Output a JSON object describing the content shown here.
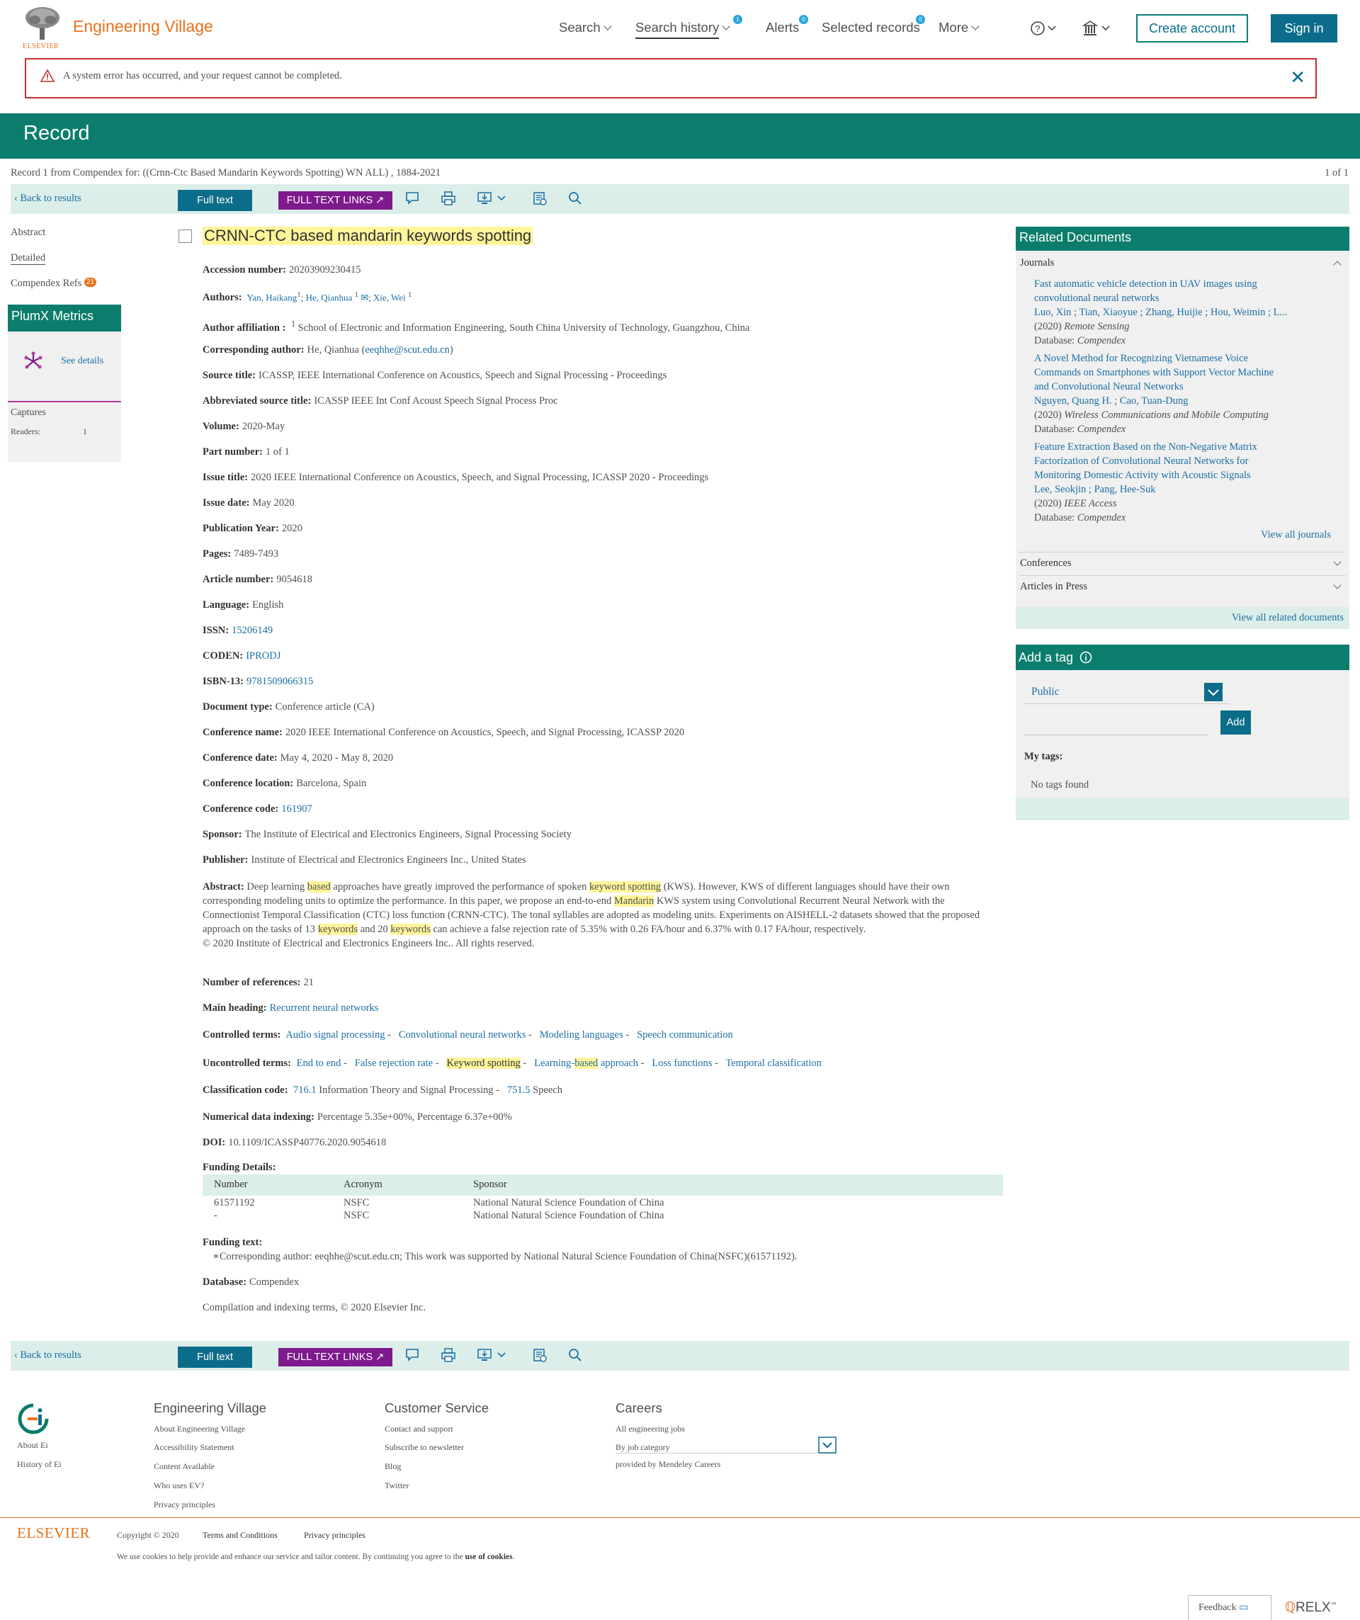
{
  "header": {
    "brand": "Engineering Village",
    "elsevier_small": "ELSEVIER",
    "nav": {
      "search": "Search",
      "search_history": "Search history",
      "search_history_badge": "1",
      "alerts": "Alerts",
      "alerts_badge": "0",
      "selected_records": "Selected records",
      "selected_badge": "0",
      "more": "More"
    },
    "create_account": "Create account",
    "sign_in": "Sign in"
  },
  "error": {
    "text": "A system error has occurred, and your request cannot be completed."
  },
  "record_bar": {
    "title": "Record"
  },
  "record_line": "Record 1 from Compendex for: ((Crnn-Ctc Based Mandarin Keywords Spotting) WN ALL) , 1884-2021",
  "of_line": "1 of 1",
  "toolbar": {
    "back": "Back to results",
    "full_text": "Full text",
    "full_text_links": "FULL TEXT LINKS"
  },
  "left_nav": {
    "abstract": "Abstract",
    "detailed": "Detailed",
    "compendex_refs": "Compendex Refs",
    "refs_count": "21",
    "plumx_title": "PlumX Metrics",
    "see_details": "See details",
    "captures": "Captures",
    "readers_label": "Readers:",
    "readers_value": "1"
  },
  "record": {
    "title": "CRNN-CTC based mandarin keywords spotting",
    "accession_label": "Accession number:",
    "accession": "20203909230415",
    "authors_label": "Authors:",
    "author1": "Yan, Haikang",
    "author2": "He, Qianhua",
    "author3": "Xie, Wei",
    "sup": "1",
    "affiliation_label": "Author affiliation :",
    "affiliation": "School of Electronic and Information Engineering, South China University of Technology, Guangzhou, China",
    "corresponding_label": "Corresponding author:",
    "corresponding_name": "He, Qianhua (",
    "corresponding_email": "eeqhhe@scut.edu.cn",
    "corresponding_close": ")",
    "source_label": "Source title:",
    "source": "ICASSP, IEEE International Conference on Acoustics, Speech and Signal Processing - Proceedings",
    "abbr_label": "Abbreviated source title:",
    "abbr": "ICASSP IEEE Int Conf Acoust Speech Signal Process Proc",
    "volume_label": "Volume:",
    "volume": "2020-May",
    "part_label": "Part number:",
    "part": "1 of 1",
    "issue_title_label": "Issue title:",
    "issue_title": "2020 IEEE International Conference on Acoustics, Speech, and Signal Processing, ICASSP 2020 - Proceedings",
    "issue_date_label": "Issue date:",
    "issue_date": "May 2020",
    "pub_year_label": "Publication Year:",
    "pub_year": "2020",
    "pages_label": "Pages:",
    "pages": "7489-7493",
    "article_label": "Article number:",
    "article": "9054618",
    "language_label": "Language:",
    "language": "English",
    "issn_label": "ISSN:",
    "issn": "15206149",
    "coden_label": "CODEN:",
    "coden": "IPRODJ",
    "isbn_label": "ISBN-13:",
    "isbn": "9781509066315",
    "doctype_label": "Document type:",
    "doctype": "Conference article (CA)",
    "conf_name_label": "Conference name:",
    "conf_name": "2020 IEEE International Conference on Acoustics, Speech, and Signal Processing, ICASSP 2020",
    "conf_date_label": "Conference date:",
    "conf_date": "May 4, 2020 - May 8, 2020",
    "conf_loc_label": "Conference location:",
    "conf_loc": "Barcelona, Spain",
    "conf_code_label": "Conference code:",
    "conf_code": "161907",
    "sponsor_label": "Sponsor:",
    "sponsor": "The Institute of Electrical and Electronics Engineers, Signal Processing Society",
    "publisher_label": "Publisher:",
    "publisher": "Institute of Electrical and Electronics Engineers Inc., United States",
    "abstract_label": "Abstract:",
    "abstract_parts": [
      "Deep learning ",
      "based",
      " approaches have greatly improved the performance of spoken ",
      "keyword spotting",
      " (KWS). However, KWS of different languages should have their own corresponding modeling units to optimize the performance. In this paper, we propose an end-to-end ",
      "Mandarin",
      " KWS system using Convolutional Recurrent Neural Network with the Connectionist Temporal Classification (CTC) loss function (CRNN-CTC). The tonal syllables are adopted as modeling units. Experiments on AISHELL-2 datasets showed that the proposed approach on the tasks of 13 ",
      "keywords",
      " and 20 ",
      "keywords",
      " can achieve a false rejection rate of 5.35% with 0.26 FA/hour and 6.37% with 0.17 FA/hour, respectively."
    ],
    "copyright": "© 2020 Institute of Electrical and Electronics Engineers Inc.. All rights reserved.",
    "num_refs_label": "Number of references:",
    "num_refs": "21",
    "main_heading_label": "Main heading:",
    "main_heading": "Recurrent neural networks",
    "controlled_label": "Controlled terms:",
    "controlled": [
      "Audio signal processing",
      "Convolutional neural networks",
      "Modeling languages",
      "Speech communication"
    ],
    "uncontrolled_label": "Uncontrolled terms:",
    "uncontrolled": [
      "End to end",
      "False rejection rate",
      "Keyword spotting",
      "Learning-",
      "based",
      " approach",
      "Loss functions",
      "Temporal classification"
    ],
    "class_label": "Classification code:",
    "class1_code": "716.1",
    "class1_text": "Information Theory and Signal Processing",
    "class2_code": "751.5",
    "class2_text": "Speech",
    "numerical_label": "Numerical data indexing:",
    "numerical": "Percentage 5.35e+00%, Percentage 6.37e+00%",
    "doi_label": "DOI:",
    "doi": "10.1109/ICASSP40776.2020.9054618",
    "funding_label": "Funding Details:",
    "funding_headers": [
      "Number",
      "Acronym",
      "Sponsor"
    ],
    "funding_rows": [
      [
        "61571192",
        "NSFC",
        "National Natural Science Foundation of China"
      ],
      [
        "-",
        "NSFC",
        "National Natural Science Foundation of China"
      ]
    ],
    "funding_text_label": "Funding text:",
    "funding_text": "∗Corresponding author: eeqhhe@scut.edu.cn; This work was supported by National Natural Science Foundation of China(NSFC)(61571192).",
    "database_label": "Database:",
    "database": "Compendex",
    "compilation": "Compilation and indexing terms, © 2020 Elsevier Inc."
  },
  "related": {
    "title": "Related Documents",
    "journals": "Journals",
    "items": [
      {
        "t1": "Fast automatic vehicle detection in UAV images using",
        "t2": "convolutional neural networks",
        "t3": "",
        "authors": "Luo, Xin ; Tian, Xiaoyue ; Zhang, Huijie ; Hou, Weimin ; L...",
        "year": "(2020) ",
        "venue": "Remote Sensing",
        "db_label": "Database: ",
        "db": "Compendex"
      },
      {
        "t1": "A Novel Method for Recognizing Vietnamese Voice",
        "t2": "Commands on Smartphones with Support Vector Machine",
        "t3": "and Convolutional Neural Networks",
        "authors": "Nguyen, Quang H. ; Cao, Tuan-Dung",
        "year": "(2020) ",
        "venue": "Wireless Communications and Mobile Computing",
        "db_label": "Database: ",
        "db": "Compendex"
      },
      {
        "t1": "Feature Extraction Based on the Non-Negative Matrix",
        "t2": "Factorization of Convolutional Neural Networks for",
        "t3": "Monitoring Domestic Activity with Acoustic Signals",
        "authors": "Lee, Seokjin ; Pang, Hee-Suk",
        "year": "(2020) ",
        "venue": "IEEE Access",
        "db_label": "Database: ",
        "db": "Compendex"
      }
    ],
    "view_all_journals": "View all journals",
    "conferences": "Conferences",
    "articles_in_press": "Articles in Press",
    "view_all_related": "View all related documents"
  },
  "tag": {
    "title": "Add a tag",
    "visibility": "Public",
    "add": "Add",
    "my_tags": "My tags:",
    "no_tags": "No tags found"
  },
  "footer": {
    "about_ei": "About Ei",
    "history_ei": "History of Ei",
    "col1_head": "Engineering Village",
    "col1": [
      "About Engineering Village",
      "Accessibility Statement",
      "Content Available",
      "Who uses EV?",
      "Privacy principles"
    ],
    "col2_head": "Customer Service",
    "col2": [
      "Contact and support",
      "Subscribe to newsletter",
      "Blog",
      "Twitter"
    ],
    "col3_head": "Careers",
    "col3": [
      "All engineering jobs",
      "By job category",
      "provided by Mendeley Careers"
    ],
    "elsevier": "ELSEVIER",
    "copyright": "Copyright © 2020",
    "terms": "Terms and Conditions",
    "privacy": "Privacy principles",
    "cookies_pre": "We use cookies to help provide and enhance our service and tailor content. By continuing you agree to the ",
    "cookies_link": "use of cookies",
    "cookies_post": ".",
    "feedback": "Feedback",
    "relx": "RELX"
  },
  "colors": {
    "teal": "#0c7d6c",
    "blue": "#0c6d8a",
    "orange": "#e9711c",
    "purple": "#7d1a8c",
    "highlight": "#fff59a"
  }
}
